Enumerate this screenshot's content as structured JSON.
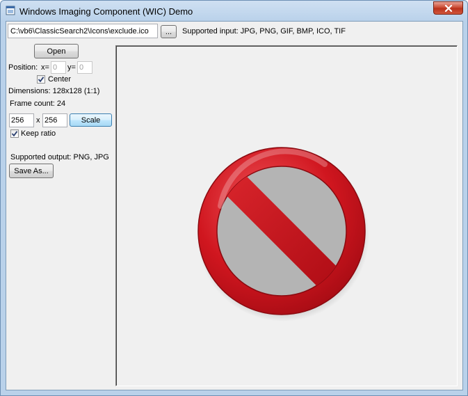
{
  "window": {
    "title": "Windows Imaging Component (WIC) Demo",
    "close_icon": "close-icon"
  },
  "file": {
    "path": "C:\\vb6\\ClassicSearch2\\Icons\\exclude.ico",
    "browse_label": "...",
    "supported_input": "Supported input: JPG, PNG, GIF, BMP, ICO, TIF"
  },
  "controls": {
    "open_label": "Open",
    "position_label": "Position:",
    "x_label": "x=",
    "x_value": "0",
    "y_label": "y=",
    "y_value": "0",
    "center_label": "Center",
    "center_checked": true,
    "dimensions": "Dimensions: 128x128 (1:1)",
    "frame_count": "Frame count: 24",
    "scale_w": "256",
    "scale_x": "x",
    "scale_h": "256",
    "scale_label": "Scale",
    "keep_ratio_label": "Keep ratio",
    "keep_ratio_checked": true,
    "supported_output": "Supported output: PNG, JPG",
    "save_as_label": "Save As..."
  },
  "image": {
    "icon": "no-entry-icon",
    "ring_color": "#c8101a",
    "highlight_color": "#e85a5e"
  }
}
